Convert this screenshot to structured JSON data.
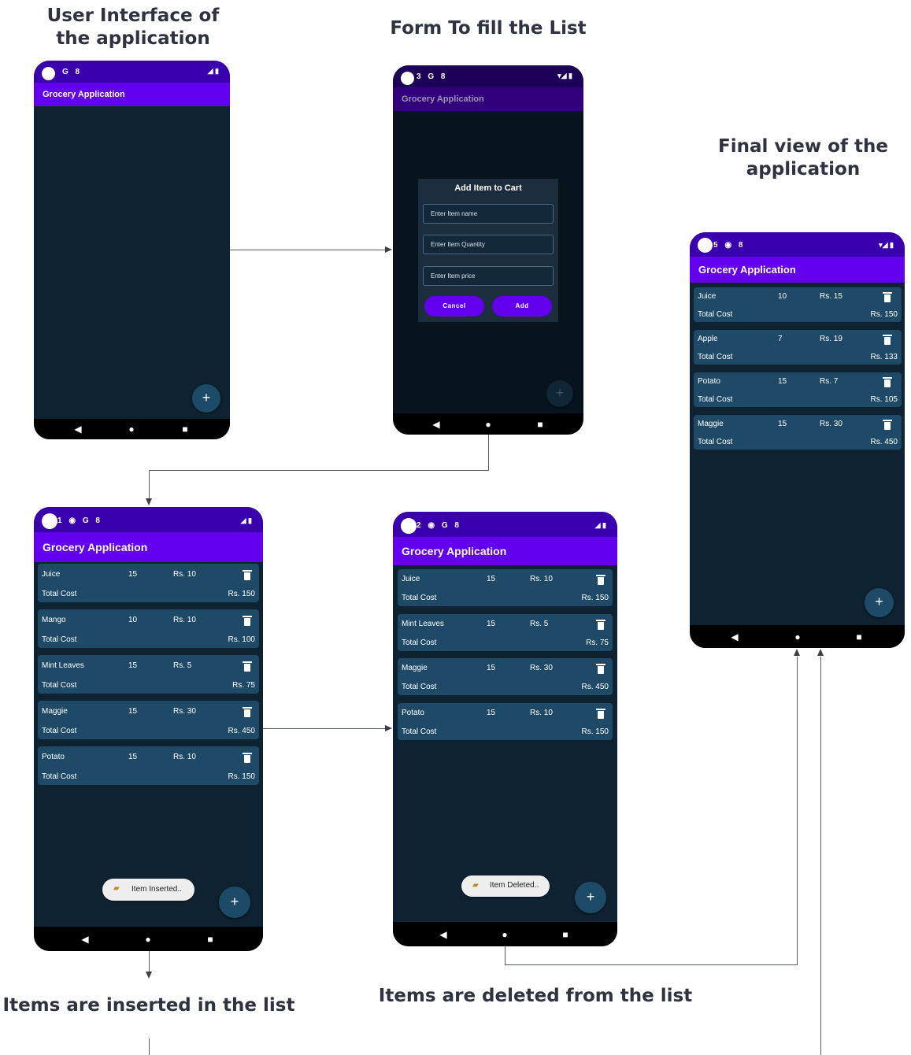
{
  "captions": {
    "ui": "User Interface of the application",
    "form": "Form To fill the List",
    "final": "Final view of the application",
    "inserted": "Items are inserted in the list",
    "deleted": "Items are deleted from the list"
  },
  "app_title": "Grocery Application",
  "status_icons": {
    "p1": "G 8",
    "p2": "3 G 8",
    "p3": "1 ◉ G 8",
    "p4": "2 ◉ G 8",
    "p5": "5 ◉ 8"
  },
  "total_label": "Total Cost",
  "fab_symbol": "+",
  "nav": {
    "back": "◀",
    "home": "●",
    "recent": "■"
  },
  "dialog": {
    "title": "Add Item to Cart",
    "name_placeholder": "Enter Item name",
    "quantity_placeholder": "Enter Item Quantity",
    "price_placeholder": "Enter Item price",
    "cancel": "Cancel",
    "add": "Add"
  },
  "inserted_list": [
    {
      "name": "Juice",
      "qty": "15",
      "price": "Rs. 10",
      "total": "Rs. 150"
    },
    {
      "name": "Mango",
      "qty": "10",
      "price": "Rs. 10",
      "total": "Rs. 100"
    },
    {
      "name": "Mint Leaves",
      "qty": "15",
      "price": "Rs. 5",
      "total": "Rs. 75"
    },
    {
      "name": "Maggie",
      "qty": "15",
      "price": "Rs. 30",
      "total": "Rs. 450"
    },
    {
      "name": "Potato",
      "qty": "15",
      "price": "Rs. 10",
      "total": "Rs. 150"
    }
  ],
  "deleted_list": [
    {
      "name": "Juice",
      "qty": "15",
      "price": "Rs. 10",
      "total": "Rs. 150"
    },
    {
      "name": "Mint Leaves",
      "qty": "15",
      "price": "Rs. 5",
      "total": "Rs. 75"
    },
    {
      "name": "Maggie",
      "qty": "15",
      "price": "Rs. 30",
      "total": "Rs. 450"
    },
    {
      "name": "Potato",
      "qty": "15",
      "price": "Rs. 10",
      "total": "Rs. 150"
    }
  ],
  "final_list": [
    {
      "name": "Juice",
      "qty": "10",
      "price": "Rs. 15",
      "total": "Rs. 150"
    },
    {
      "name": "Apple",
      "qty": "7",
      "price": "Rs. 19",
      "total": "Rs. 133"
    },
    {
      "name": "Potato",
      "qty": "15",
      "price": "Rs. 7",
      "total": "Rs. 105"
    },
    {
      "name": "Maggie",
      "qty": "15",
      "price": "Rs. 30",
      "total": "Rs. 450"
    }
  ],
  "toasts": {
    "inserted": "Item Inserted..",
    "deleted": "Item Deleted.."
  },
  "colors": {
    "status_bar": "#3a00ad",
    "app_bar": "#6300ee",
    "background": "#0f2231",
    "card": "#1e4a67",
    "fab": "#1d4a66"
  }
}
